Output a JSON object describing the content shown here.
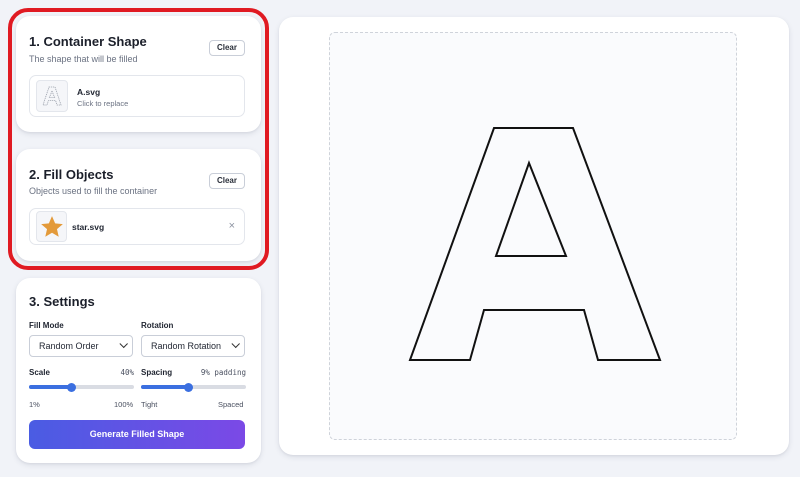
{
  "container_section": {
    "title": "1. Container Shape",
    "subtitle": "The shape that will be filled",
    "clear_label": "Clear",
    "file": {
      "name": "A.svg",
      "hint": "Click to replace",
      "icon": "letter-a-outline-thumbnail"
    }
  },
  "fill_section": {
    "title": "2. Fill Objects",
    "subtitle": "Objects used to fill the container",
    "clear_label": "Clear",
    "items": [
      {
        "name": "star.svg",
        "icon": "star-icon",
        "remove_label": "×",
        "color": "#e39a3a"
      }
    ]
  },
  "settings": {
    "title": "3. Settings",
    "fill_mode": {
      "label": "Fill Mode",
      "selected": "Random Order"
    },
    "rotation": {
      "label": "Rotation",
      "selected": "Random Rotation"
    },
    "scale": {
      "label": "Scale",
      "value_text": "40%",
      "min_label": "1%",
      "max_label": "100%",
      "fraction": 0.4
    },
    "spacing": {
      "label": "Spacing",
      "value_text": "9% padding",
      "min_label": "Tight",
      "max_label": "Spaced",
      "fraction": 0.45
    },
    "generate_label": "Generate Filled Shape"
  },
  "preview": {
    "shape_letter": "A"
  },
  "colors": {
    "accent": "#3b6fe0",
    "highlight": "#e01a22",
    "gradient_start": "#4a5ce3",
    "gradient_end": "#7b49e6"
  }
}
